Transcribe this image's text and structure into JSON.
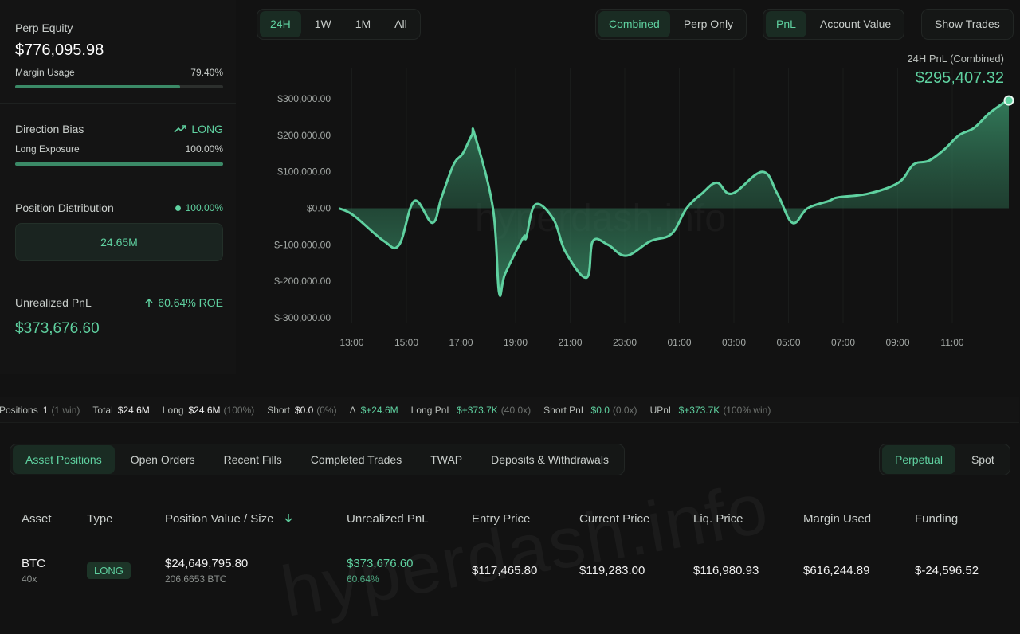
{
  "left": {
    "perp_equity_label": "Perp Equity",
    "perp_equity_value": "$776,095.98",
    "margin_usage_label": "Margin Usage",
    "margin_usage_value": "79.40%",
    "margin_usage_fraction": 0.794,
    "direction_bias_label": "Direction Bias",
    "direction_bias_value": "LONG",
    "long_exposure_label": "Long Exposure",
    "long_exposure_value": "100.00%",
    "long_exposure_fraction": 1.0,
    "position_distribution_label": "Position Distribution",
    "position_distribution_pct": "100.00%",
    "position_distribution_value": "24.65M",
    "unrealized_pnl_label": "Unrealized PnL",
    "roe_value": "60.64% ROE",
    "unrealized_pnl_value": "$373,676.60"
  },
  "chart_controls": {
    "ranges": [
      "24H",
      "1W",
      "1M",
      "All"
    ],
    "active_range": "24H",
    "modes": [
      "Combined",
      "Perp Only"
    ],
    "active_mode": "Combined",
    "metrics": [
      "PnL",
      "Account Value"
    ],
    "active_metric": "PnL",
    "show_trades": "Show Trades"
  },
  "chart_header": {
    "title": "24H PnL (Combined)",
    "value": "$295,407.32"
  },
  "chart_data": {
    "type": "area",
    "ylim": [
      -300000,
      300000
    ],
    "y_ticks": [
      "$300,000.00",
      "$200,000.00",
      "$100,000.00",
      "$0.00",
      "$-100,000.00",
      "$-200,000.00",
      "$-300,000.00"
    ],
    "x_ticks": [
      "13:00",
      "15:00",
      "17:00",
      "19:00",
      "21:00",
      "23:00",
      "01:00",
      "03:00",
      "05:00",
      "07:00",
      "09:00",
      "11:00"
    ],
    "x_hours": [
      12.5,
      13.0,
      14.0,
      14.5,
      15.0,
      15.6,
      15.9,
      16.3,
      16.6,
      16.9,
      17.0,
      17.6,
      17.8,
      18.0,
      18.6,
      18.7,
      19.0,
      19.6,
      20.0,
      20.7,
      20.9,
      21.4,
      22.0,
      22.8,
      23.5,
      24.0,
      24.5,
      25.0,
      25.5,
      26.5,
      27.0,
      27.5,
      28.0,
      28.7,
      29.0,
      30.0,
      31.0,
      31.5,
      32.0,
      32.5,
      33.0,
      33.5,
      34.0,
      34.5,
      34.65
    ],
    "values": [
      0,
      -20000,
      -90000,
      -100000,
      20000,
      -40000,
      30000,
      120000,
      150000,
      200000,
      200000,
      0,
      -230000,
      -180000,
      -80000,
      -80000,
      10000,
      -30000,
      -120000,
      -190000,
      -90000,
      -100000,
      -130000,
      -90000,
      -70000,
      0,
      40000,
      70000,
      40000,
      100000,
      40000,
      -40000,
      0,
      20000,
      30000,
      40000,
      70000,
      120000,
      130000,
      160000,
      200000,
      220000,
      260000,
      290000,
      295407
    ]
  },
  "stats": [
    {
      "label": "Positions",
      "value": "1",
      "extra": "(1 win)",
      "green": false
    },
    {
      "label": "Total",
      "value": "$24.6M",
      "extra": "",
      "green": false
    },
    {
      "label": "Long",
      "value": "$24.6M",
      "extra": "(100%)",
      "green": false
    },
    {
      "label": "Short",
      "value": "$0.0",
      "extra": "(0%)",
      "green": false
    },
    {
      "label": "Δ",
      "value": "$+24.6M",
      "extra": "",
      "green": true
    },
    {
      "label": "Long PnL",
      "value": "$+373.7K",
      "extra": "(40.0x)",
      "green": true
    },
    {
      "label": "Short PnL",
      "value": "$0.0",
      "extra": "(0.0x)",
      "green": true
    },
    {
      "label": "UPnL",
      "value": "$+373.7K",
      "extra": "(100% win)",
      "green": true
    }
  ],
  "tabs": [
    "Asset Positions",
    "Open Orders",
    "Recent Fills",
    "Completed Trades",
    "TWAP",
    "Deposits & Withdrawals"
  ],
  "active_tab": "Asset Positions",
  "market_tabs": [
    "Perpetual",
    "Spot"
  ],
  "active_market": "Perpetual",
  "table": {
    "headers": [
      "Asset",
      "Type",
      "Position Value / Size",
      "Unrealized PnL",
      "Entry Price",
      "Current Price",
      "Liq. Price",
      "Margin Used",
      "Funding"
    ],
    "row": {
      "asset": "BTC",
      "leverage": "40x",
      "type": "LONG",
      "position_value": "$24,649,795.80",
      "position_size": "206.6653 BTC",
      "upnl": "$373,676.60",
      "upnl_pct": "60.64%",
      "entry_price": "$117,465.80",
      "current_price": "$119,283.00",
      "liq_price": "$116,980.93",
      "margin_used": "$616,244.89",
      "funding": "$-24,596.52"
    }
  },
  "watermark": "hyperdash.info",
  "colors": {
    "accent": "#5fd1a0",
    "negative": "#e46a6a",
    "bg": "#121212"
  }
}
